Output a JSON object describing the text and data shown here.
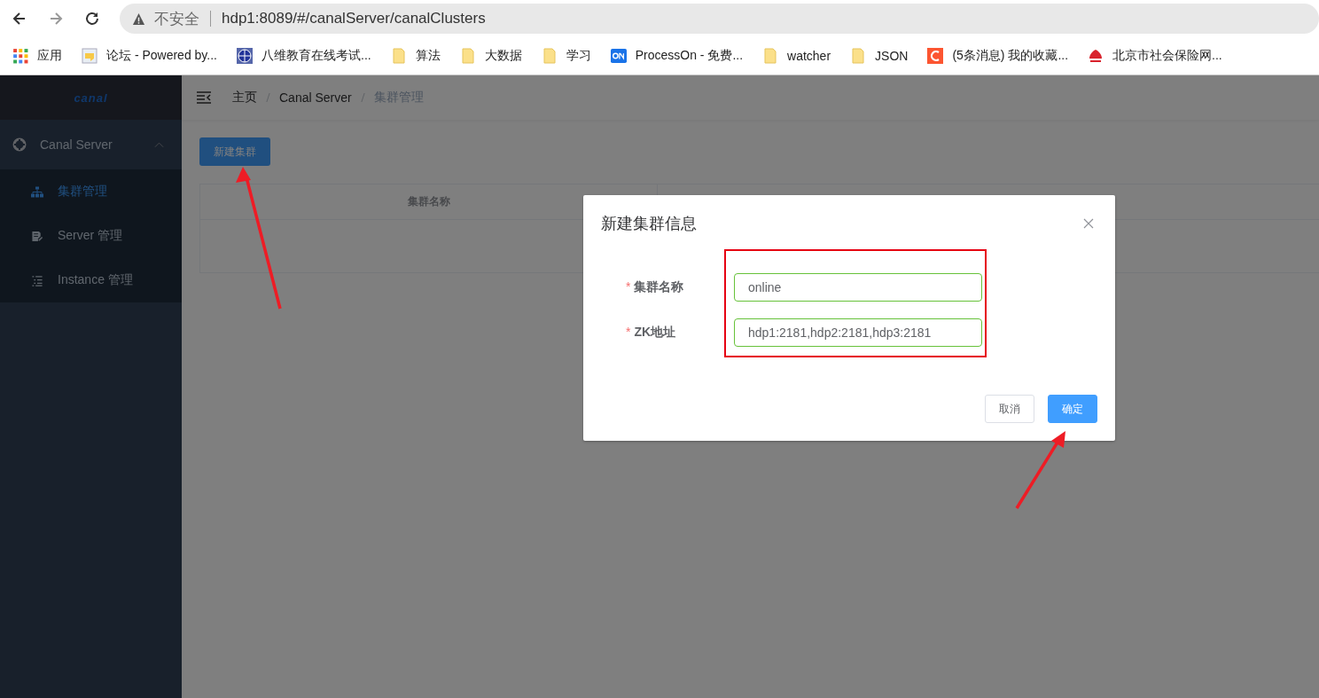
{
  "browser": {
    "security": "不安全",
    "url": "hdp1:8089/#/canalServer/canalClusters",
    "bookmarks": [
      {
        "kind": "apps",
        "label": "应用"
      },
      {
        "kind": "forum",
        "label": "论坛 - Powered by..."
      },
      {
        "kind": "globe",
        "label": "八维教育在线考试..."
      },
      {
        "kind": "folder",
        "label": "算法"
      },
      {
        "kind": "folder",
        "label": "大数据"
      },
      {
        "kind": "folder",
        "label": "学习"
      },
      {
        "kind": "processon",
        "label": "ProcessOn - 免费..."
      },
      {
        "kind": "folder",
        "label": "watcher"
      },
      {
        "kind": "folder",
        "label": "JSON"
      },
      {
        "kind": "csdn",
        "label": "(5条消息) 我的收藏..."
      },
      {
        "kind": "social",
        "label": "北京市社会保险网..."
      }
    ]
  },
  "sidebar": {
    "logo": "canal",
    "menu": [
      {
        "label": "Canal Server",
        "expanded": true,
        "children": [
          {
            "kind": "sitemap",
            "label": "集群管理",
            "selected": true
          },
          {
            "kind": "doc",
            "label": "Server 管理",
            "selected": false
          },
          {
            "kind": "list",
            "label": "Instance 管理",
            "selected": false
          }
        ]
      }
    ]
  },
  "breadcrumb": [
    {
      "label": "主页",
      "current": false
    },
    {
      "label": "Canal Server",
      "current": false
    },
    {
      "label": "集群管理",
      "current": true
    }
  ],
  "new_button": "新建集群",
  "table": {
    "columns": [
      "集群名称"
    ]
  },
  "modal": {
    "title": "新建集群信息",
    "fields": [
      {
        "label": "集群名称",
        "required_mark": "*",
        "value": "online"
      },
      {
        "label": "ZK地址",
        "required_mark": "*",
        "value": "hdp1:2181,hdp2:2181,hdp3:2181"
      }
    ],
    "buttons": [
      {
        "label": "取消",
        "kind": "default"
      },
      {
        "label": "确定",
        "kind": "primary"
      }
    ]
  }
}
